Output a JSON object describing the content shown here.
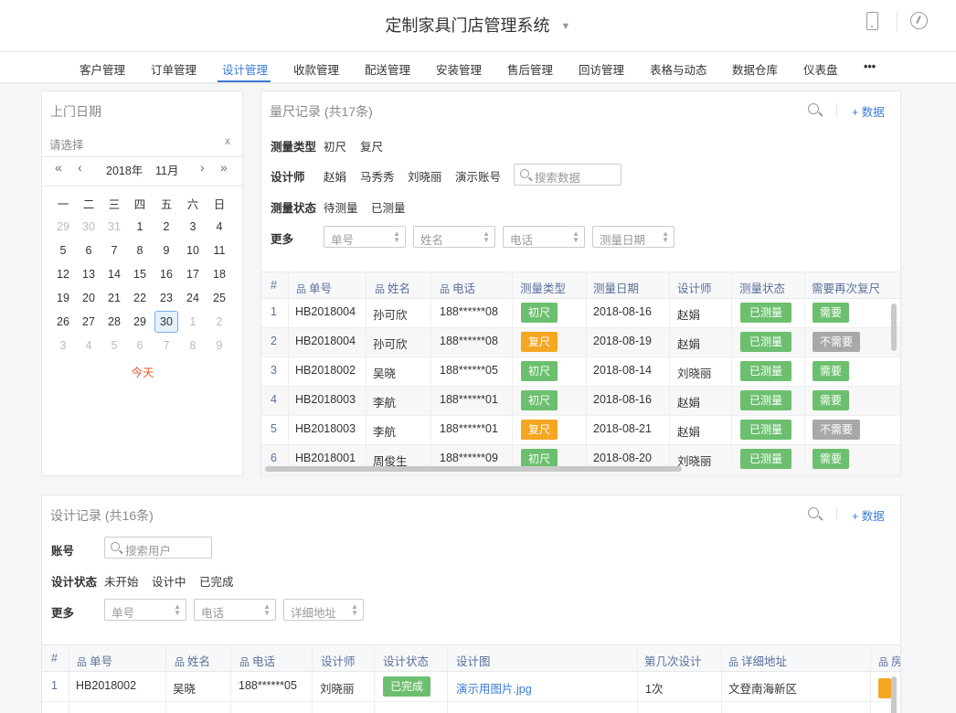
{
  "header": {
    "title": "定制家具门店管理系统"
  },
  "nav": {
    "items": [
      "客户管理",
      "订单管理",
      "设计管理",
      "收款管理",
      "配送管理",
      "安装管理",
      "售后管理",
      "回访管理",
      "表格与动态",
      "数据仓库",
      "仪表盘",
      "•••"
    ],
    "active_index": 2
  },
  "calendar": {
    "title": "上门日期",
    "placeholder": "请选择",
    "clear": "x",
    "prev_year": "«",
    "prev_month": "‹",
    "next_month": "›",
    "next_year": "»",
    "year": "2018年",
    "month": "11月",
    "weekdays": [
      "一",
      "二",
      "三",
      "四",
      "五",
      "六",
      "日"
    ],
    "days": [
      [
        "29",
        "30",
        "31",
        "1",
        "2",
        "3",
        "4"
      ],
      [
        "5",
        "6",
        "7",
        "8",
        "9",
        "10",
        "11"
      ],
      [
        "12",
        "13",
        "14",
        "15",
        "16",
        "17",
        "18"
      ],
      [
        "19",
        "20",
        "21",
        "22",
        "23",
        "24",
        "25"
      ],
      [
        "26",
        "27",
        "28",
        "29",
        "30",
        "1",
        "2"
      ],
      [
        "3",
        "4",
        "5",
        "6",
        "7",
        "8",
        "9"
      ]
    ],
    "selected_day": "30",
    "today_label": "今天"
  },
  "measure": {
    "title": "量尺记录 (共17条)",
    "add_label": "+ 数据",
    "filters": {
      "type_label": "测量类型",
      "type_options": [
        "初尺",
        "复尺"
      ],
      "designer_label": "设计师",
      "designer_options": [
        "赵娟",
        "马秀秀",
        "刘晓丽",
        "演示账号"
      ],
      "search_placeholder": "搜索数据",
      "status_label": "测量状态",
      "status_options": [
        "待测量",
        "已测量"
      ],
      "more_label": "更多",
      "more_selects": [
        "单号",
        "姓名",
        "电话",
        "测量日期"
      ]
    },
    "columns": [
      "#",
      "单号",
      "姓名",
      "电话",
      "测量类型",
      "测量日期",
      "设计师",
      "测量状态",
      "需要再次复尺"
    ],
    "rows": [
      {
        "idx": "1",
        "no": "HB2018004",
        "name": "孙可欣",
        "phone": "188******08",
        "type": "初尺",
        "date": "2018-08-16",
        "designer": "赵娟",
        "status": "已测量",
        "again": "需要"
      },
      {
        "idx": "2",
        "no": "HB2018004",
        "name": "孙可欣",
        "phone": "188******08",
        "type": "复尺",
        "date": "2018-08-19",
        "designer": "赵娟",
        "status": "已测量",
        "again": "不需要"
      },
      {
        "idx": "3",
        "no": "HB2018002",
        "name": "吴晓",
        "phone": "188******05",
        "type": "初尺",
        "date": "2018-08-14",
        "designer": "刘晓丽",
        "status": "已测量",
        "again": "需要"
      },
      {
        "idx": "4",
        "no": "HB2018003",
        "name": "李航",
        "phone": "188******01",
        "type": "初尺",
        "date": "2018-08-16",
        "designer": "赵娟",
        "status": "已测量",
        "again": "需要"
      },
      {
        "idx": "5",
        "no": "HB2018003",
        "name": "李航",
        "phone": "188******01",
        "type": "复尺",
        "date": "2018-08-21",
        "designer": "赵娟",
        "status": "已测量",
        "again": "不需要"
      },
      {
        "idx": "6",
        "no": "HB2018001",
        "name": "周俊生",
        "phone": "188******09",
        "type": "初尺",
        "date": "2018-08-20",
        "designer": "刘晓丽",
        "status": "已测量",
        "again": "需要"
      }
    ]
  },
  "design": {
    "title": "设计记录 (共16条)",
    "add_label": "+ 数据",
    "filters": {
      "account_label": "账号",
      "search_placeholder": "搜索用户",
      "status_label": "设计状态",
      "status_options": [
        "未开始",
        "设计中",
        "已完成"
      ],
      "more_label": "更多",
      "more_selects": [
        "单号",
        "电话",
        "详细地址"
      ]
    },
    "columns": [
      "#",
      "单号",
      "姓名",
      "电话",
      "设计师",
      "设计状态",
      "设计图",
      "第几次设计",
      "详细地址",
      "房"
    ],
    "rows": [
      {
        "idx": "1",
        "no": "HB2018002",
        "name": "吴晓",
        "phone": "188******05",
        "designer": "刘晓丽",
        "status": "已完成",
        "image": "演示用图片.jpg",
        "times": "1次",
        "address": "文登南海新区"
      }
    ]
  },
  "colors": {
    "accent": "#3a7bd5",
    "green": "#6cbf6f",
    "orange": "#f5a623",
    "gray": "#a8a8a8",
    "today": "#e05a2b"
  }
}
